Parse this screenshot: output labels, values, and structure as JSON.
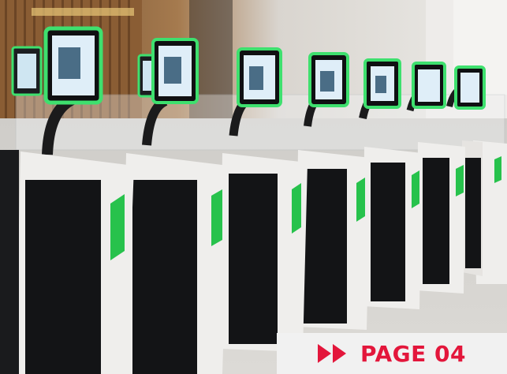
{
  "photo": {
    "subject": "airport-egate-kiosks",
    "colors": {
      "screen_glow": "#3ee06e",
      "gate_body": "#efeeec",
      "gate_panel": "#111214",
      "arrow_sign": "#27c24c",
      "floor": "#d7d5d1",
      "ceiling": "#e9e7e3",
      "wood_wall": "#9a6b3f"
    },
    "icons": [
      "green-arrow-sign-icon",
      "kiosk-screen-icon"
    ]
  },
  "badge": {
    "text": "PAGE 04",
    "icon": "double-chevron-right-icon",
    "color": "#e3163b"
  }
}
